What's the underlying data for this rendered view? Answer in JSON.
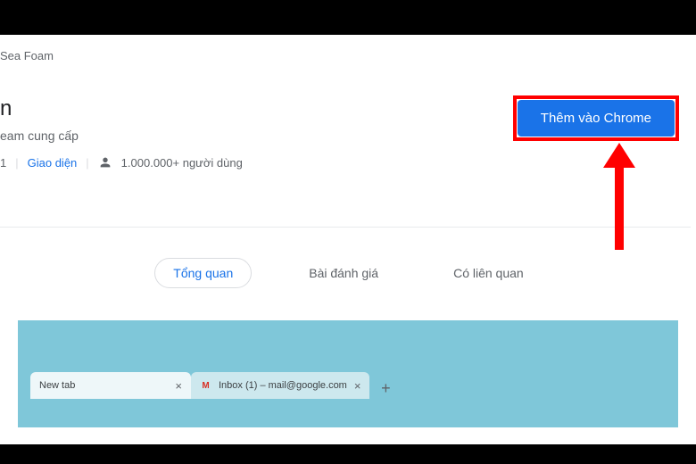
{
  "breadcrumb": "Sea Foam",
  "title_suffix": "n",
  "provider_text": "eam cung cấp",
  "meta_left": "1",
  "category": "Giao diện",
  "users_text": "1.000.000+ người dùng",
  "add_button": "Thêm vào Chrome",
  "tabs": {
    "overview": "Tổng quan",
    "reviews": "Bài đánh giá",
    "related": "Có liên quan"
  },
  "preview": {
    "tab1": {
      "label": "New tab"
    },
    "tab2": {
      "label": "Inbox (1) – mail@google.com"
    }
  }
}
